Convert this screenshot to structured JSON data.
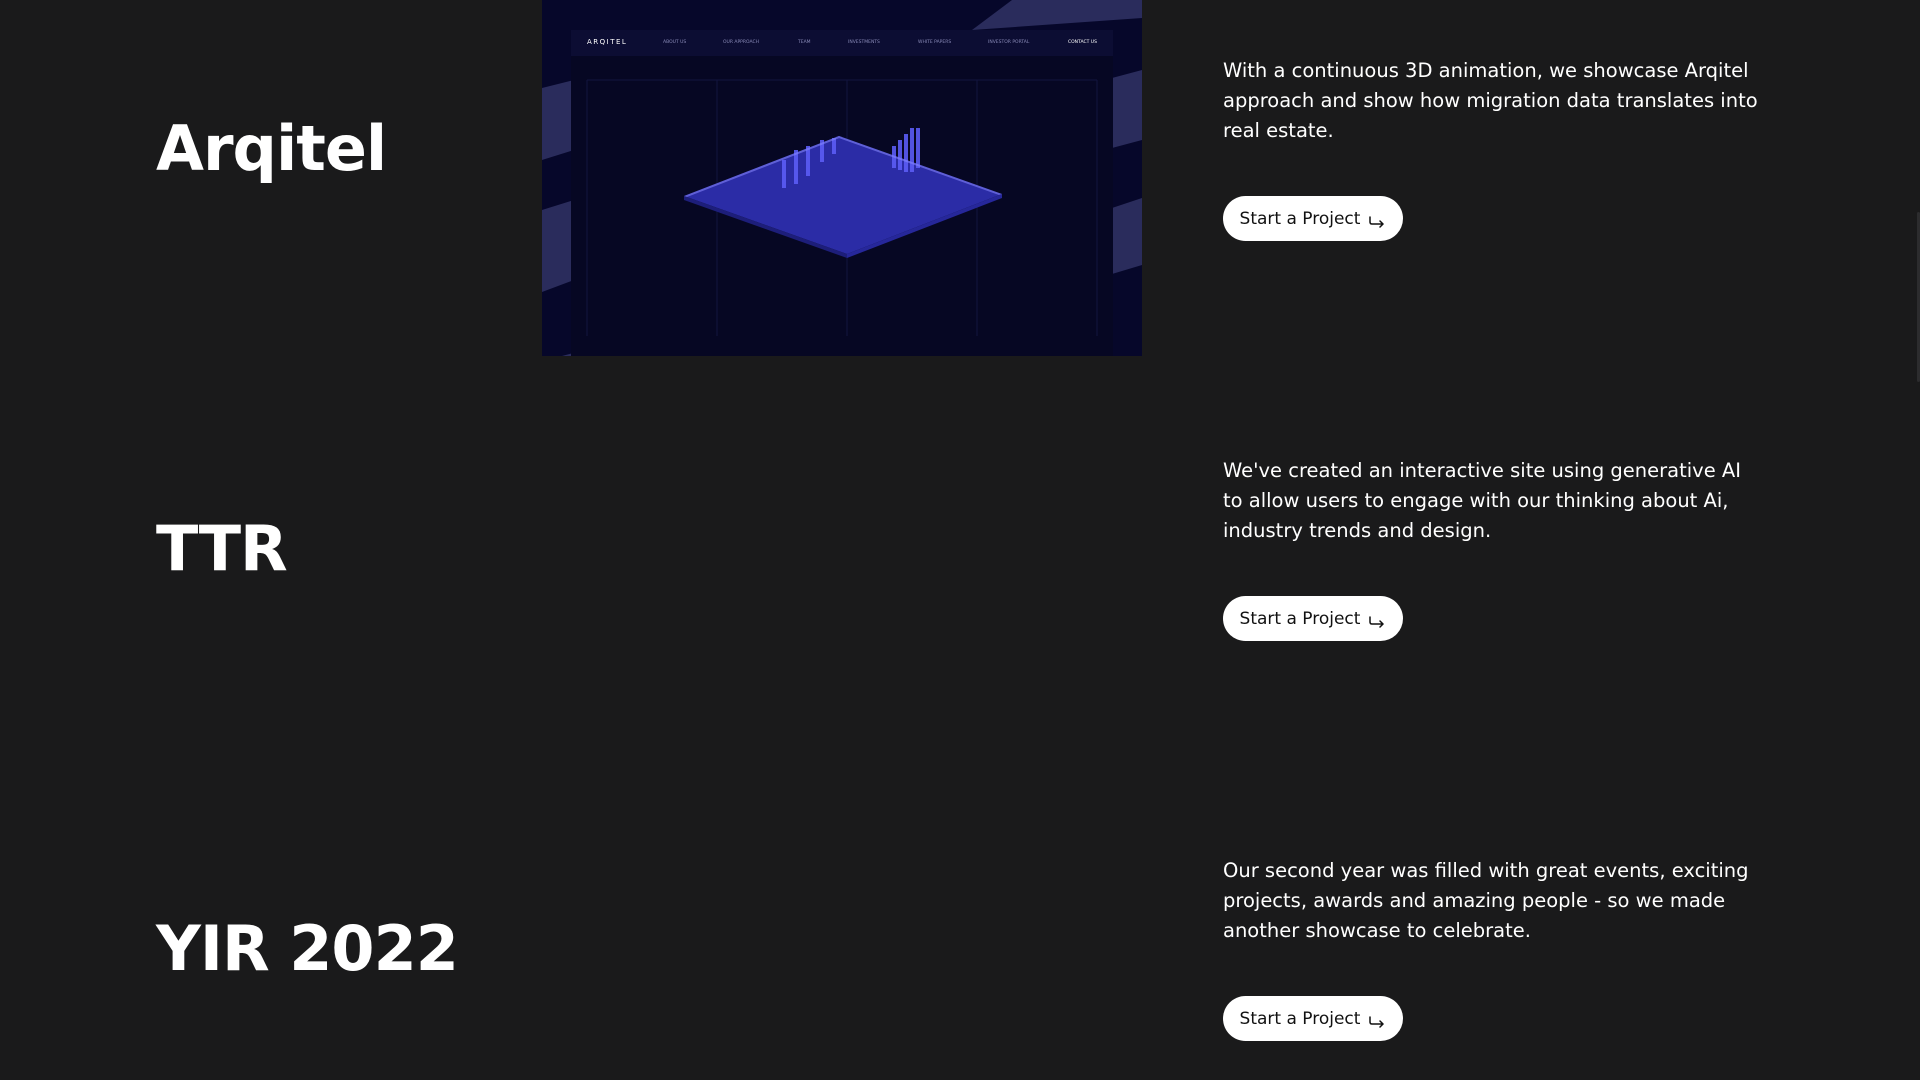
{
  "projects": [
    {
      "title": "Arqitel",
      "description": "With a continuous 3D animation, we showcase Arqitel approach and show how migration data translates into real estate.",
      "cta_label": "Start a Project"
    },
    {
      "title": "TTR",
      "description": "We've created an interactive site using generative AI to allow users to engage with our thinking about Ai, industry trends and design.",
      "cta_label": "Start a Project"
    },
    {
      "title": "YIR 2022",
      "description": "Our second year was filled with great events, exciting projects, awards and amazing people - so we made another showcase to celebrate.",
      "cta_label": "Start a Project"
    }
  ],
  "preview": {
    "logo": "ARQITEL",
    "nav": [
      "ABOUT US",
      "OUR APPROACH",
      "TEAM",
      "INVESTMENTS",
      "WHITE PAPERS",
      "INVESTOR PORTAL",
      "CONTACT US"
    ]
  },
  "colors": {
    "background": "#1a1a1b",
    "button_bg": "#ffffff",
    "preview_bg": "#06072a",
    "bar_accent": "#4b4cf0"
  },
  "icons": {
    "cta": "arrow-hook-right-icon"
  }
}
